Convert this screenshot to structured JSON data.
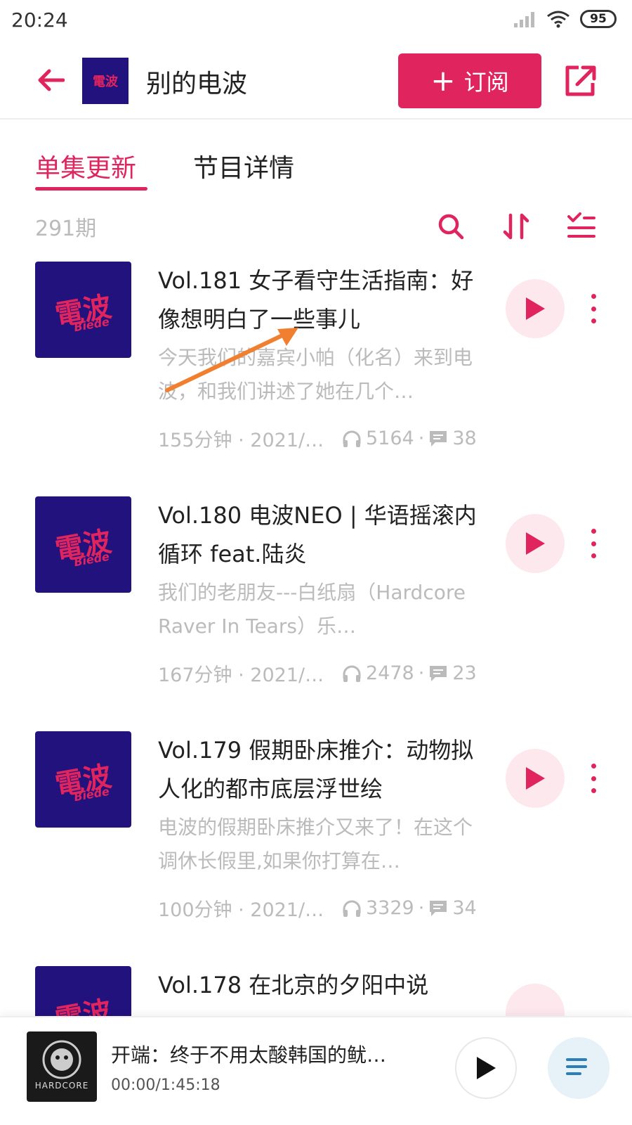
{
  "status_bar": {
    "time": "20:24",
    "battery": "95"
  },
  "header": {
    "logo_text": "電波",
    "title": "别的电波",
    "subscribe_label": "订阅",
    "subscribe_plus": "+"
  },
  "tabs": [
    {
      "label": "单集更新",
      "active": true
    },
    {
      "label": "节目详情",
      "active": false
    }
  ],
  "episode_count": "291期",
  "cover": {
    "main": "電波",
    "sub": "Biede"
  },
  "episodes": [
    {
      "title": "Vol.181 女子看守生活指南：好像想明白了一些事儿",
      "desc": "今天我们的嘉宾小帕（化名）来到电波，和我们讲述了她在几个…",
      "duration": "155分钟 · 2021/…",
      "plays": "5164",
      "comments": "38"
    },
    {
      "title": "Vol.180 电波NEO | 华语摇滚内循环 feat.陆炎",
      "desc": "我们的老朋友---白纸扇（Hardcore Raver In Tears）乐…",
      "duration": "167分钟 · 2021/…",
      "plays": "2478",
      "comments": "23"
    },
    {
      "title": "Vol.179 假期卧床推介：动物拟人化的都市底层浮世绘",
      "desc": "电波的假期卧床推介又来了！在这个调休长假里,如果你打算在…",
      "duration": "100分钟 · 2021/…",
      "plays": "3329",
      "comments": "34"
    },
    {
      "title": "Vol.178 在北京的夕阳中说"
    }
  ],
  "player": {
    "cover_text": "HARDCORE",
    "title": "开端：终于不用太酸韩国的鱿…",
    "time": "00:00/1:45:18"
  },
  "colors": {
    "accent": "#e0245e",
    "cover_bg": "#22127e",
    "muted_text": "#bbbbbb"
  },
  "icons": [
    "back-arrow-icon",
    "share-icon",
    "search-icon",
    "sort-icon",
    "filter-list-icon",
    "play-icon",
    "more-vertical-icon",
    "headphones-icon",
    "comment-icon",
    "playlist-icon"
  ]
}
